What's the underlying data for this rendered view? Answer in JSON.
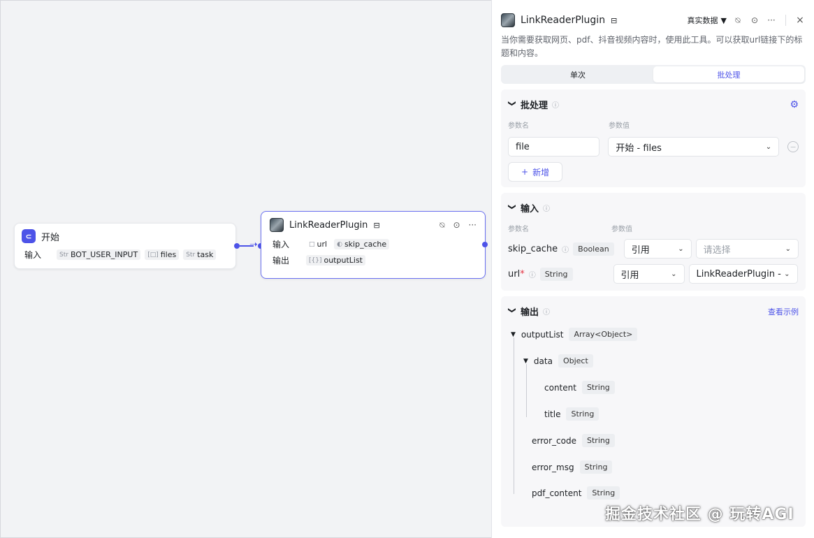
{
  "start_node": {
    "title": "开始",
    "icon": "start-icon",
    "input_label": "输入",
    "inputs": [
      {
        "prefix": "Str",
        "name": "BOT_USER_INPUT"
      },
      {
        "prefix": "[□]",
        "name": "files"
      },
      {
        "prefix": "Str",
        "name": "task"
      }
    ]
  },
  "plugin_node": {
    "title": "LinkReaderPlugin",
    "input_label": "输入",
    "output_label": "输出",
    "inputs": [
      {
        "icon": "□",
        "name": "url"
      },
      {
        "icon": "◐",
        "name": "skip_cache"
      }
    ],
    "outputs": [
      {
        "icon": "[{}]",
        "name": "outputList"
      }
    ]
  },
  "panel": {
    "title": "LinkReaderPlugin",
    "data_mode": "真实数据",
    "description": "当你需要获取网页、pdf、抖音视频内容时，使用此工具。可以获取url链接下的标题和内容。",
    "tabs": {
      "single": "单次",
      "batch": "批处理"
    },
    "batch": {
      "title": "批处理",
      "col_name": "参数名",
      "col_value": "参数值",
      "param_name": "file",
      "param_value": "开始 - files",
      "add_label": "新增"
    },
    "input": {
      "title": "输入",
      "col_name": "参数名",
      "col_value": "参数值",
      "rows": [
        {
          "name": "skip_cache",
          "required": false,
          "type": "Boolean",
          "mode": "引用",
          "value": "请选择",
          "placeholder": true
        },
        {
          "name": "url",
          "required": true,
          "type": "String",
          "mode": "引用",
          "value": "LinkReaderPlugin -",
          "placeholder": false
        }
      ]
    },
    "output": {
      "title": "输出",
      "example_link": "查看示例",
      "tree": {
        "outputList": {
          "name": "outputList",
          "type": "Array<Object>"
        },
        "data": {
          "name": "data",
          "type": "Object"
        },
        "content": {
          "name": "content",
          "type": "String"
        },
        "title": {
          "name": "title",
          "type": "String"
        },
        "error_code": {
          "name": "error_code",
          "type": "String"
        },
        "error_msg": {
          "name": "error_msg",
          "type": "String"
        },
        "pdf_content": {
          "name": "pdf_content",
          "type": "String"
        }
      }
    }
  },
  "watermark": "掘金技术社区 @ 玩转AGI",
  "colors": {
    "accent": "#4d53e8",
    "required": "#e53241"
  }
}
